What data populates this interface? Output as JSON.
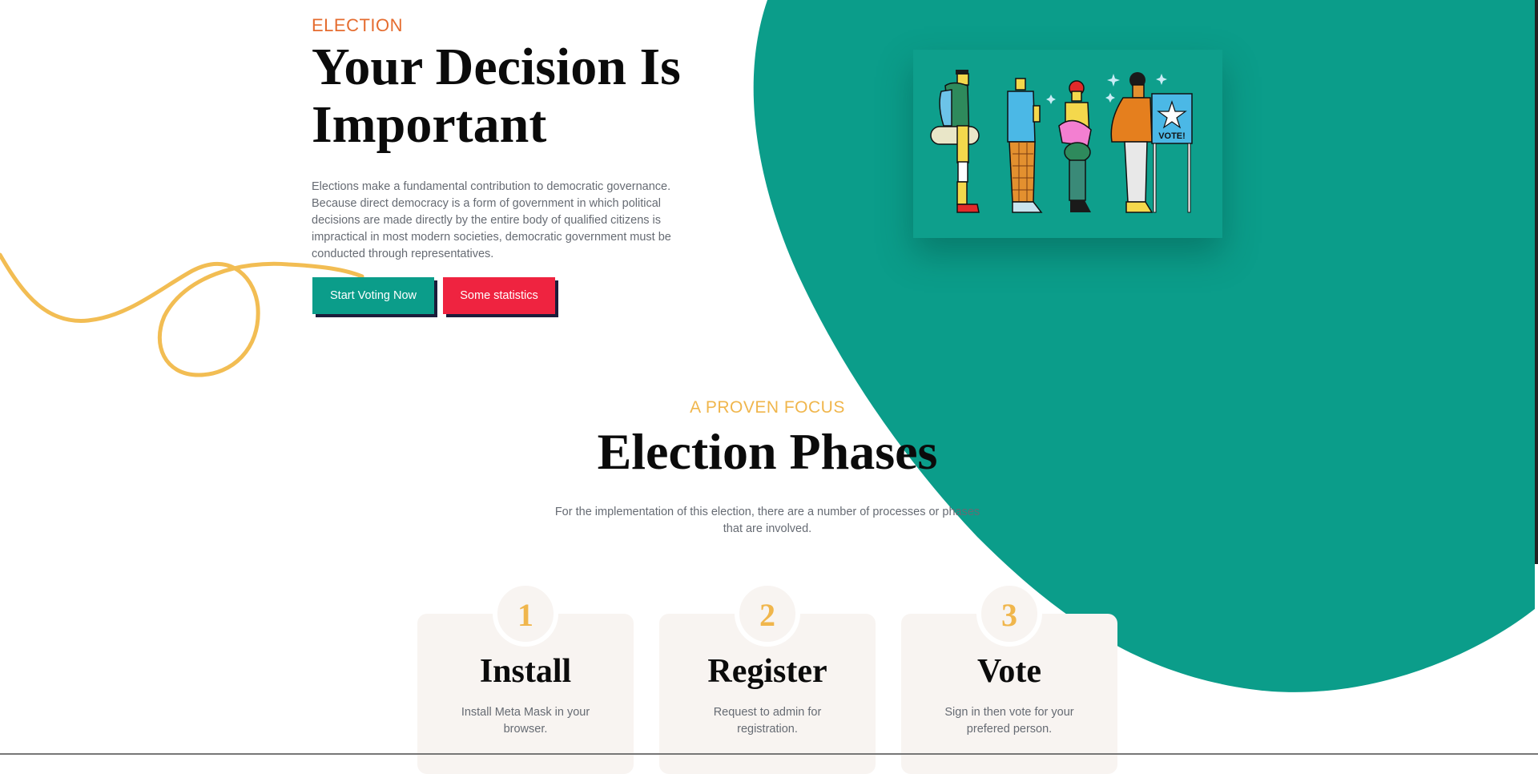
{
  "hero": {
    "eyebrow": "ELECTION",
    "title_line1": "Your Decision Is",
    "title_line2": "Important",
    "description": "Elections make a fundamental contribution to democratic governance. Because direct democracy is a form of government in which political decisions are made directly by the entire body of qualified citizens is impractical in most modern societies, democratic government must be conducted through representatives.",
    "primary_button": "Start Voting Now",
    "secondary_button": "Some statistics",
    "illustration_sign": "VOTE!"
  },
  "phases": {
    "eyebrow": "A PROVEN FOCUS",
    "title": "Election Phases",
    "description": "For the implementation of this election, there are a number of processes or phases that are involved.",
    "cards": [
      {
        "number": "1",
        "title": "Install",
        "text": "Install Meta Mask in your browser."
      },
      {
        "number": "2",
        "title": "Register",
        "text": "Request to admin for registration."
      },
      {
        "number": "3",
        "title": "Vote",
        "text": "Sign in then vote for your prefered person."
      }
    ]
  },
  "colors": {
    "teal": "#0b9d8a",
    "red": "#ef2340",
    "orange": "#e56c2f",
    "gold": "#f0b64c",
    "card_bg": "#f8f4f1"
  },
  "icons": [
    "squiggle-decoration",
    "teal-blob-background",
    "voting-line-illustration"
  ]
}
